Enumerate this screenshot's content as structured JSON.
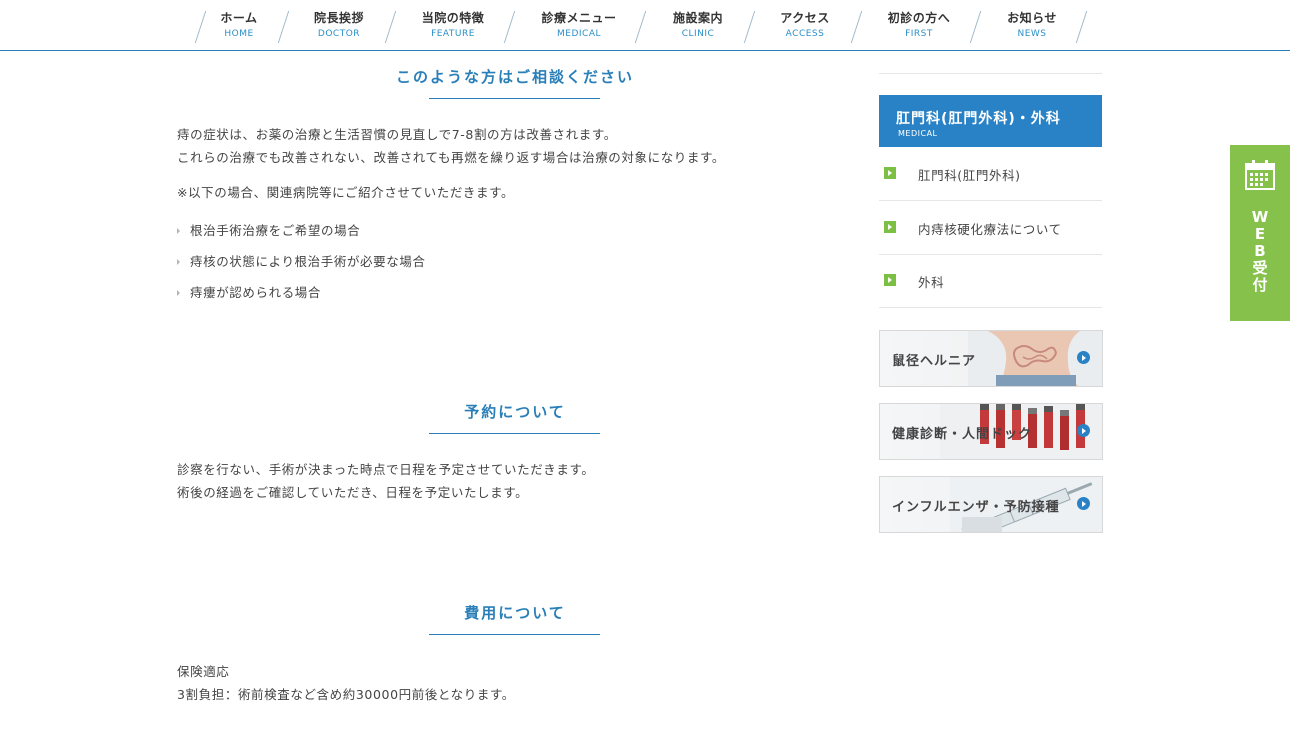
{
  "nav": {
    "items": [
      {
        "jp": "ホーム",
        "en": "HOME"
      },
      {
        "jp": "院長挨拶",
        "en": "DOCTOR"
      },
      {
        "jp": "当院の特徴",
        "en": "FEATURE"
      },
      {
        "jp": "診療メニュー",
        "en": "MEDICAL"
      },
      {
        "jp": "施設案内",
        "en": "CLINIC"
      },
      {
        "jp": "アクセス",
        "en": "ACCESS"
      },
      {
        "jp": "初診の方へ",
        "en": "FIRST"
      },
      {
        "jp": "お知らせ",
        "en": "NEWS"
      }
    ]
  },
  "main": {
    "consult": {
      "title": "このような方はご相談ください",
      "line1": "痔の症状は、お薬の治療と生活習慣の見直しで7-8割の方は改善されます。",
      "line2": "これらの治療でも改善されない、改善されても再燃を繰り返す場合は治療の対象になります。",
      "note": "※以下の場合、関連病院等にご紹介させていただきます。",
      "bullets": [
        "根治手術治療をご希望の場合",
        "痔核の状態により根治手術が必要な場合",
        "痔瘻が認められる場合"
      ]
    },
    "reservation": {
      "title": "予約について",
      "line1": "診察を行ない、手術が決まった時点で日程を予定させていただきます。",
      "line2": "術後の経過をご確認していただき、日程を予定いたします。"
    },
    "cost": {
      "title": "費用について",
      "line1": "保険適応",
      "line2": "3割負担：術前検査など含め約30000円前後となります。"
    }
  },
  "sidebar": {
    "heading_jp": "肛門科(肛門外科)・外科",
    "heading_en": "MEDICAL",
    "links": [
      "肛門科(肛門外科)",
      "内痔核硬化療法について",
      "外科"
    ],
    "banners": [
      "鼠径ヘルニア",
      "健康診断・人間ドック",
      "インフルエンザ・予防接種"
    ]
  },
  "web_tab": {
    "label": "WEB受付",
    "chars": [
      "W",
      "E",
      "B",
      "受",
      "付"
    ]
  },
  "colors": {
    "accent_blue": "#2a7fb8",
    "sidebar_head": "#2a82c6",
    "green": "#86c14b",
    "arrow_green": "#7cc043"
  }
}
